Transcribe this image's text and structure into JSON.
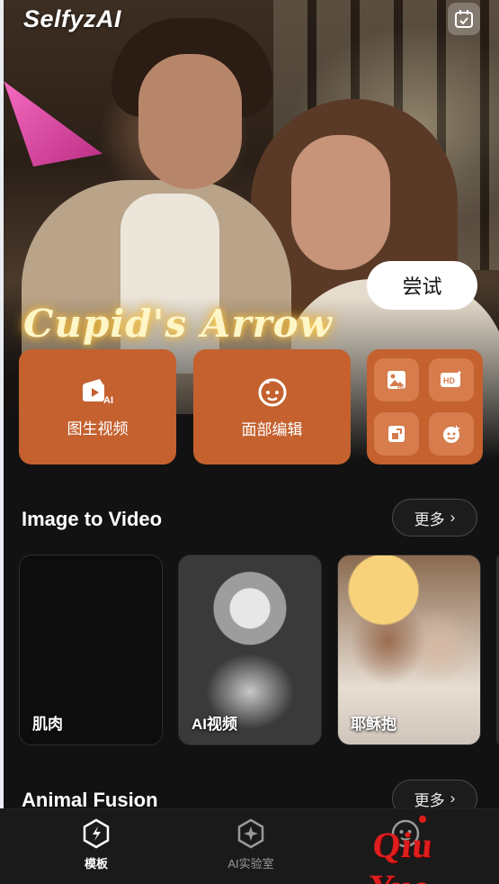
{
  "app": {
    "logo": "SelfyzAI"
  },
  "banner": {
    "title": "Cupid's Arrow",
    "try_label": "尝试"
  },
  "features": {
    "image_to_video": "图生视频",
    "face_edit": "面部编辑",
    "mini_tools": [
      "ai-image-icon",
      "hd-icon",
      "crop-icon",
      "face-sticker-icon"
    ]
  },
  "sections": [
    {
      "title": "Image to Video",
      "more": "更多",
      "cards": [
        {
          "label": "肌肉"
        },
        {
          "label": "AI视频"
        },
        {
          "label": "耶稣抱"
        }
      ]
    },
    {
      "title": "Animal Fusion",
      "more": "更多"
    }
  ],
  "nav": [
    {
      "label": "模板",
      "active": true
    },
    {
      "label": "AI实验室",
      "active": false
    },
    {
      "label": "",
      "active": false
    }
  ],
  "watermark": "Qiu  Yue",
  "colors": {
    "accent": "#c4612f",
    "background": "#121212",
    "nav_bg": "#1a1a1a"
  }
}
